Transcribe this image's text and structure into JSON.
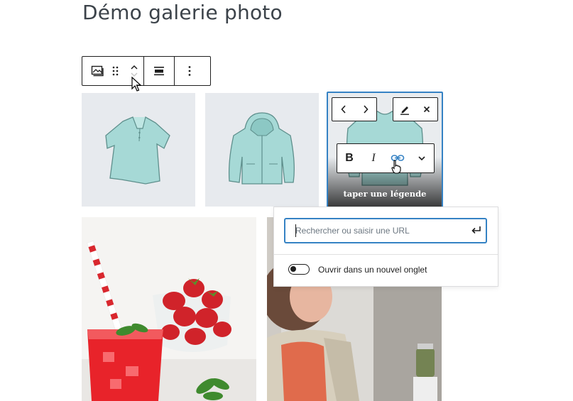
{
  "page": {
    "title": "Démo galerie photo"
  },
  "block_toolbar": {
    "change_type_icon": "gallery-icon",
    "drag_icon": "drag-handle-icon",
    "move_up_icon": "chevron-up-icon",
    "move_down_icon": "chevron-down-icon",
    "align_icon": "align-icon",
    "more_icon": "more-vertical-icon"
  },
  "gallery": {
    "items": [
      {
        "name": "polo-shirt-image"
      },
      {
        "name": "zip-hoodie-image"
      },
      {
        "name": "sweatshirt-image",
        "selected": true,
        "caption_placeholder": "taper une légende"
      }
    ],
    "image_nav": {
      "prev_icon": "chevron-left-icon",
      "next_icon": "chevron-right-icon"
    },
    "image_actions": {
      "edit_icon": "pencil-icon",
      "remove_icon": "close-icon"
    },
    "format_toolbar": {
      "bold": "B",
      "italic": "I",
      "link_icon": "link-icon",
      "more_icon": "chevron-down-icon"
    }
  },
  "link_popover": {
    "url_placeholder": "Rechercher ou saisir une URL",
    "url_value": "",
    "submit_icon": "enter-icon",
    "new_tab_label": "Ouvrir dans un nouvel onglet",
    "new_tab_enabled": false
  },
  "colors": {
    "accent": "#3582c4",
    "text": "#1e1e1e",
    "tile_bg": "#e7eaee",
    "garment": "#a6d9d6"
  }
}
